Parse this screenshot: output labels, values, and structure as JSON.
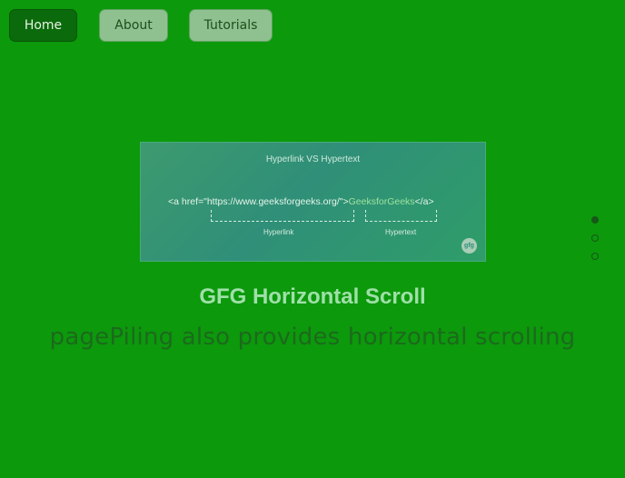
{
  "nav": {
    "items": [
      {
        "label": "Home",
        "active": true
      },
      {
        "label": "About",
        "active": false
      },
      {
        "label": "Tutorials",
        "active": false
      }
    ]
  },
  "card": {
    "title": "Hyperlink VS Hypertext",
    "code_open": "<a href=\"https://www.geeksforgeeks.org/\">",
    "code_text": "GeeksforGeeks",
    "code_close": "</a>",
    "label_hyperlink": "Hyperlink",
    "label_hypertext": "Hypertext",
    "watermark": "gfg"
  },
  "section": {
    "heading": "GFG Horizontal Scroll",
    "subheading": "pagePiling also provides horizontal scrolling"
  },
  "side_nav": {
    "dots": [
      {
        "active": true
      },
      {
        "active": false
      },
      {
        "active": false
      }
    ]
  },
  "colors": {
    "background": "#0c990c",
    "nav_active_bg": "#0b6a0b",
    "nav_inactive_bg": "#8fc08f",
    "heading": "#9fe0a8",
    "subheading": "#1c6a1c"
  }
}
